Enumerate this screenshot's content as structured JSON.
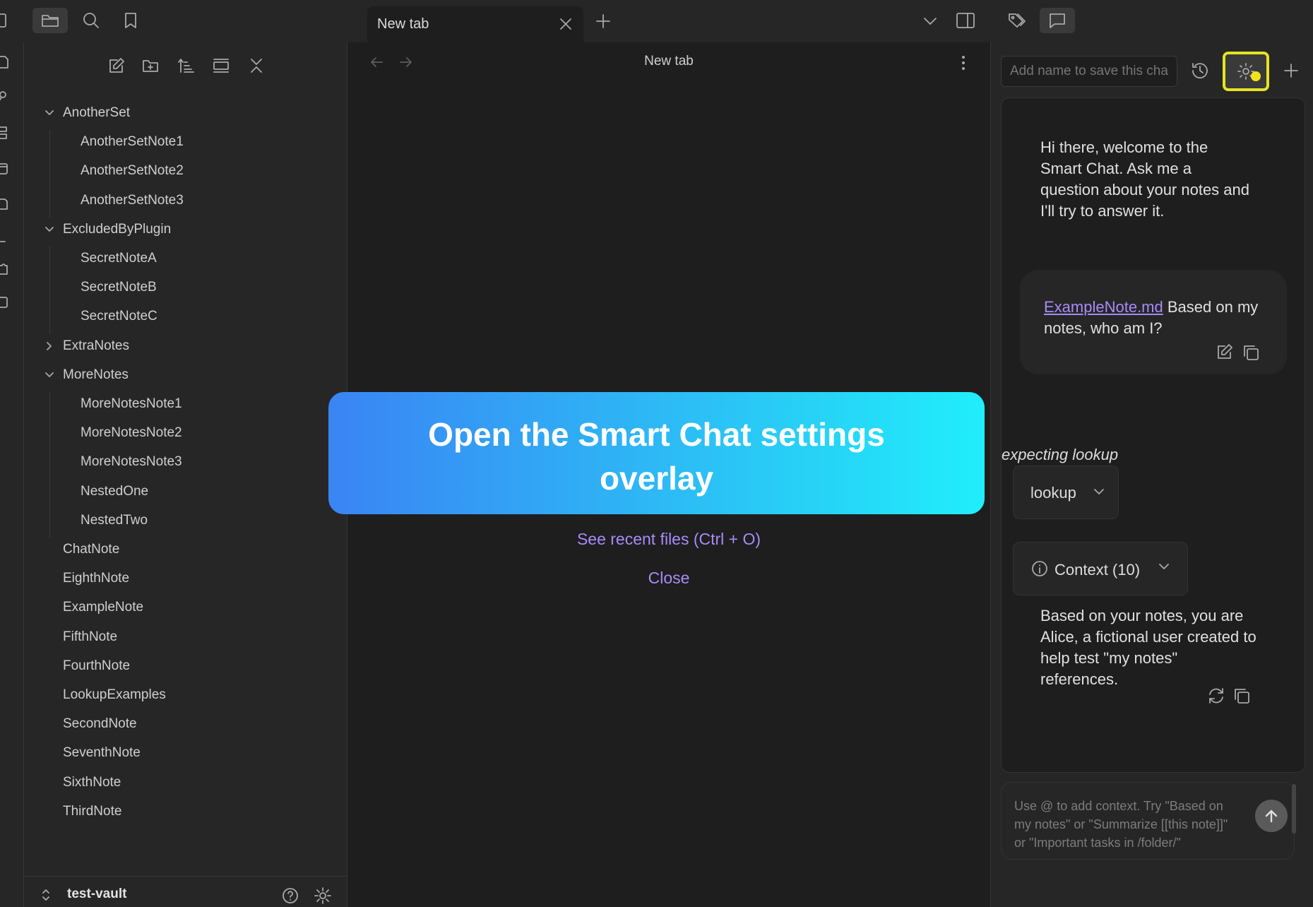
{
  "tab": {
    "title": "New tab"
  },
  "sidebar": {
    "tree": [
      {
        "label": "AnotherSet",
        "expanded": true,
        "children": [
          "AnotherSetNote1",
          "AnotherSetNote2",
          "AnotherSetNote3"
        ]
      },
      {
        "label": "ExcludedByPlugin",
        "expanded": true,
        "children": [
          "SecretNoteA",
          "SecretNoteB",
          "SecretNoteC"
        ]
      },
      {
        "label": "ExtraNotes",
        "expanded": false,
        "children": []
      },
      {
        "label": "MoreNotes",
        "expanded": true,
        "children": [
          "MoreNotesNote1",
          "MoreNotesNote2",
          "MoreNotesNote3",
          "NestedOne",
          "NestedTwo"
        ]
      }
    ],
    "files": [
      "ChatNote",
      "EighthNote",
      "ExampleNote",
      "FifthNote",
      "FourthNote",
      "LookupExamples",
      "SecondNote",
      "SeventhNote",
      "SixthNote",
      "ThirdNote"
    ],
    "vault_name": "test-vault"
  },
  "main": {
    "title": "New tab",
    "recent_files_link": "See recent files (Ctrl + O)",
    "close_link": "Close"
  },
  "overlay": {
    "line1": "Open the Smart Chat settings",
    "line2": "overlay"
  },
  "chat": {
    "name_placeholder": "Add name to save this chat",
    "welcome": "Hi there, welcome to the Smart Chat. Ask me a question about your notes and I'll try to answer it.",
    "user_link": "ExampleNote.md",
    "user_text": " Based on my notes, who am I?",
    "expecting": "expecting lookup",
    "lookup_label": "lookup",
    "context_label": "Context (10)",
    "answer": "Based on your notes, you are Alice, a fictional user created to help test \"my notes\" references.",
    "input_placeholder": "Use @ to add context. Try \"Based on my notes\" or \"Summarize [[this note]]\" or \"Important tasks in /folder/\""
  },
  "colors": {
    "accent": "#a88bfa",
    "highlight": "#e5e322",
    "banner_start": "#3a84f4",
    "banner_end": "#20eefc"
  }
}
